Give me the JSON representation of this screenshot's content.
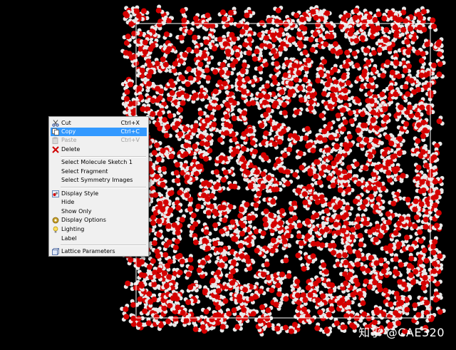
{
  "context_menu": {
    "items": [
      {
        "label": "Cut",
        "shortcut": "Ctrl+X",
        "icon": "scissors-icon",
        "state": "normal"
      },
      {
        "label": "Copy",
        "shortcut": "Ctrl+C",
        "icon": "copy-icon",
        "state": "selected"
      },
      {
        "label": "Paste",
        "shortcut": "Ctrl+V",
        "icon": "paste-icon",
        "state": "disabled"
      },
      {
        "label": "Delete",
        "shortcut": "",
        "icon": "delete-x-icon",
        "state": "normal"
      },
      {
        "label": "Select Molecule Sketch 1",
        "shortcut": "",
        "icon": "",
        "state": "normal"
      },
      {
        "label": "Select Fragment",
        "shortcut": "",
        "icon": "",
        "state": "normal"
      },
      {
        "label": "Select Symmetry Images",
        "shortcut": "",
        "icon": "",
        "state": "normal"
      },
      {
        "label": "Display Style",
        "shortcut": "",
        "icon": "display-style-icon",
        "state": "normal"
      },
      {
        "label": "Hide",
        "shortcut": "",
        "icon": "",
        "state": "normal"
      },
      {
        "label": "Show Only",
        "shortcut": "",
        "icon": "",
        "state": "normal"
      },
      {
        "label": "Display Options",
        "shortcut": "",
        "icon": "display-options-icon",
        "state": "normal"
      },
      {
        "label": "Lighting",
        "shortcut": "",
        "icon": "lighting-icon",
        "state": "normal"
      },
      {
        "label": "Label",
        "shortcut": "",
        "icon": "",
        "state": "normal"
      },
      {
        "label": "Lattice Parameters",
        "shortcut": "",
        "icon": "lattice-parameters-icon",
        "state": "normal"
      }
    ]
  },
  "watermark": "知乎 @CAE320",
  "colors": {
    "background": "#000000",
    "oxygen_atom": "#d40000",
    "hydrogen_atom": "#e8e8e8",
    "lattice_box": "#ffffff",
    "menu_highlight": "#3399ff"
  }
}
